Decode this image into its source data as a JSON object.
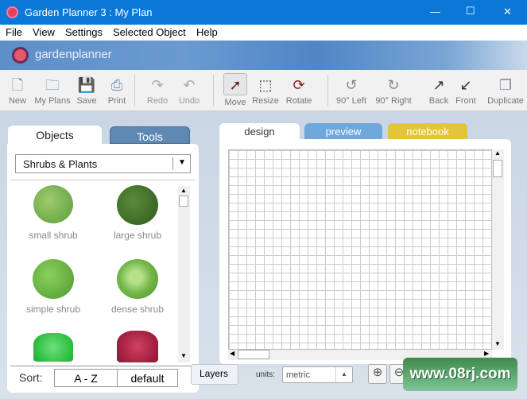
{
  "window": {
    "title": "Garden Planner 3 : My  Plan",
    "minimize": "—",
    "maximize": "☐",
    "close": "✕"
  },
  "menu": [
    "File",
    "View",
    "Settings",
    "Selected Object",
    "Help"
  ],
  "banner": {
    "brand": "gardenplanner"
  },
  "toolbar": [
    {
      "label": "New",
      "icon": "new-file-icon",
      "glyph": "🗋"
    },
    {
      "label": "My Plans",
      "icon": "folder-icon",
      "glyph": "🗀"
    },
    {
      "label": "Save",
      "icon": "save-icon",
      "glyph": "💾"
    },
    {
      "label": "Print",
      "icon": "print-icon",
      "glyph": "⎙"
    },
    {
      "label": "Redo",
      "icon": "redo-icon",
      "glyph": "↷"
    },
    {
      "label": "Undo",
      "icon": "undo-icon",
      "glyph": "↶"
    },
    {
      "label": "Move",
      "icon": "arrow-cursor-icon",
      "glyph": "➚"
    },
    {
      "label": "Resize",
      "icon": "resize-icon",
      "glyph": "⬚"
    },
    {
      "label": "Rotate",
      "icon": "rotate-icon",
      "glyph": "⟳"
    },
    {
      "label": "90° Left",
      "icon": "rotate-left-icon",
      "glyph": "↺"
    },
    {
      "label": "90° Right",
      "icon": "rotate-right-icon",
      "glyph": "↻"
    },
    {
      "label": "Back",
      "icon": "send-back-icon",
      "glyph": "↗"
    },
    {
      "label": "Front",
      "icon": "bring-front-icon",
      "glyph": "↙"
    },
    {
      "label": "Duplicate",
      "icon": "duplicate-icon",
      "glyph": "❐"
    }
  ],
  "left": {
    "tabs": [
      "Objects",
      "Tools"
    ],
    "category": "Shrubs & Plants",
    "objects": [
      {
        "name": "small shrub",
        "color": "#6aa84f"
      },
      {
        "name": "large shrub",
        "color": "#3c6e2a"
      },
      {
        "name": "simple shrub",
        "color": "#5fae3a"
      },
      {
        "name": "dense shrub",
        "color": "#7cc04a"
      },
      {
        "name": "",
        "color": "#22c03a"
      },
      {
        "name": "",
        "color": "#a3163a"
      }
    ],
    "sort_label": "Sort:",
    "sort_options": [
      "A - Z",
      "default"
    ]
  },
  "right": {
    "tabs": [
      "design",
      "preview",
      "notebook"
    ],
    "layers": "Layers",
    "units_label": "units:",
    "units_value": "metric"
  },
  "watermark": "www.08rj.com"
}
